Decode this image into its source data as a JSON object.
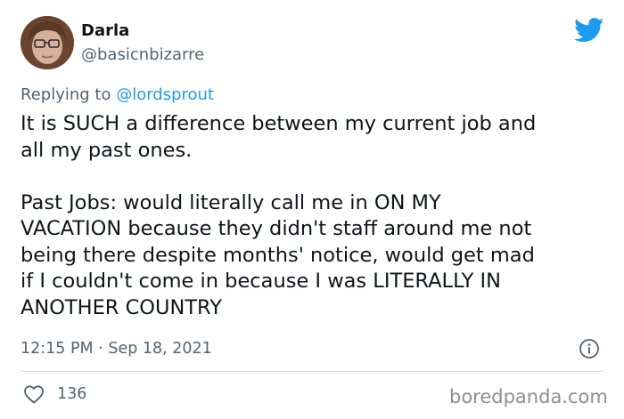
{
  "tweet": {
    "author_name": "Darla",
    "author_handle": "@basicnbizarre",
    "reply_prefix": "Replying to ",
    "reply_mention": "@lordsprout",
    "lines": [
      "It is SUCH a difference between my current job and",
      "all my past ones.",
      "",
      "Past Jobs: would literally call me in ON MY",
      "VACATION because they didn't staff around me not",
      "being there despite months' notice, would get mad",
      "if I couldn't come in because I was LITERALLY IN",
      "ANOTHER COUNTRY"
    ],
    "timestamp": "12:15 PM · Sep 18, 2021",
    "like_count": "136"
  },
  "watermark": "boredpanda.com",
  "icons": {
    "brand": "twitter-bird-icon",
    "info": "info-icon",
    "like": "heart-icon"
  },
  "colors": {
    "twitter_blue": "#1d9bf0",
    "secondary_text": "#536471",
    "primary_text": "#0f1419",
    "divider": "#cfd9de"
  }
}
